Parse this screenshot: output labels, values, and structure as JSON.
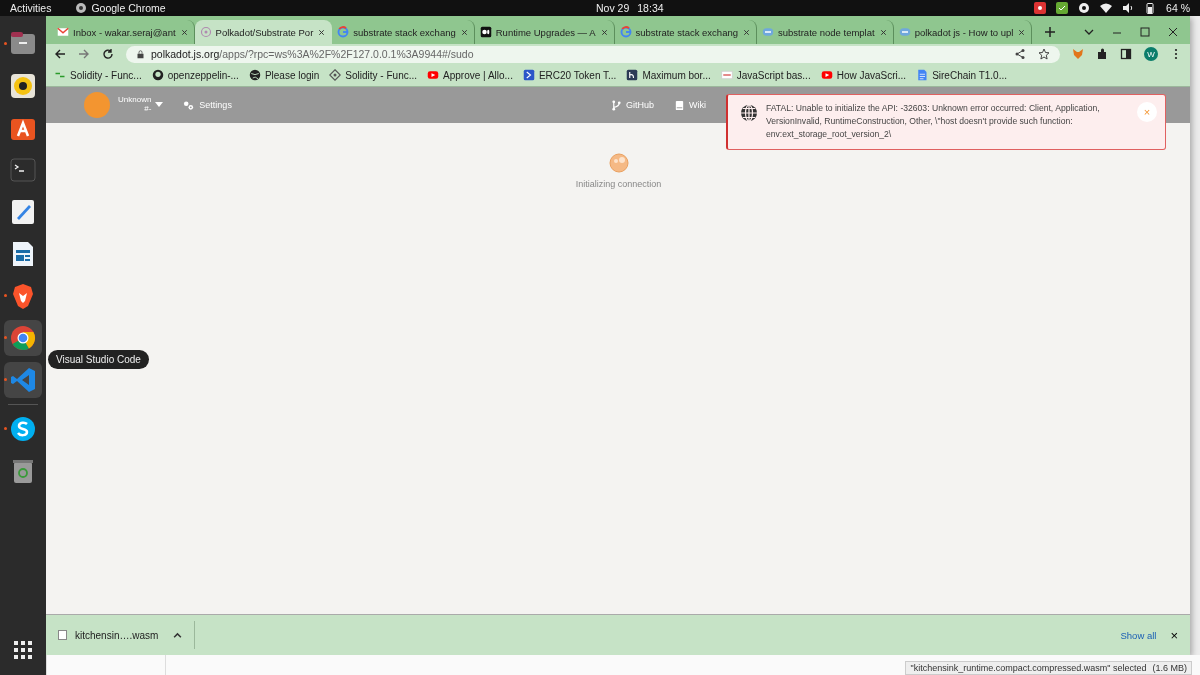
{
  "top_bar": {
    "activities": "Activities",
    "app_name": "Google Chrome",
    "date": "Nov 29",
    "time": "18:34",
    "battery": "64 %"
  },
  "dock": {
    "items": [
      {
        "kind": "files",
        "running": true,
        "highlighted": false
      },
      {
        "kind": "music",
        "running": false,
        "highlighted": false
      },
      {
        "kind": "store",
        "running": false,
        "highlighted": false
      },
      {
        "kind": "terminal",
        "running": false,
        "highlighted": false
      },
      {
        "kind": "editor",
        "running": false,
        "highlighted": false
      },
      {
        "kind": "writer",
        "running": false,
        "highlighted": false
      },
      {
        "kind": "brave",
        "running": true,
        "highlighted": false
      },
      {
        "kind": "chrome",
        "running": true,
        "highlighted": true
      },
      {
        "kind": "vscode",
        "running": true,
        "highlighted": true
      },
      {
        "kind": "skype",
        "running": true,
        "highlighted": false
      },
      {
        "kind": "trash",
        "running": false,
        "highlighted": false
      }
    ],
    "tooltip": "Visual Studio Code"
  },
  "browser": {
    "tabs": [
      {
        "kind": "gmail",
        "title": "Inbox - wakar.seraj@ant",
        "selected": false
      },
      {
        "kind": "polkadot",
        "title": "Polkadot/Substrate Por",
        "selected": true
      },
      {
        "kind": "google",
        "title": "substrate stack exchang",
        "selected": false
      },
      {
        "kind": "medium",
        "title": "Runtime Upgrades — A",
        "selected": false
      },
      {
        "kind": "google",
        "title": "substrate stack exchang",
        "selected": false
      },
      {
        "kind": "substrate",
        "title": "substrate node templat",
        "selected": false
      },
      {
        "kind": "substrate",
        "title": "polkadot js - How to upl",
        "selected": false
      }
    ],
    "url_host": "polkadot.js.org",
    "url_path": "/apps/?rpc=ws%3A%2F%2F127.0.0.1%3A9944#/sudo",
    "profile": "W",
    "bookmarks": [
      {
        "kind": "solidity",
        "label": "Solidity - Func..."
      },
      {
        "kind": "github",
        "label": "openzeppelin-..."
      },
      {
        "kind": "globe",
        "label": "Please login"
      },
      {
        "kind": "diamond",
        "label": "Solidity - Func..."
      },
      {
        "kind": "youtube",
        "label": "Approve | Allo..."
      },
      {
        "kind": "erc",
        "label": "ERC20 Token T..."
      },
      {
        "kind": "h",
        "label": "Maximum bor..."
      },
      {
        "kind": "js",
        "label": "JavaScript bas..."
      },
      {
        "kind": "youtube",
        "label": "How JavaScri..."
      },
      {
        "kind": "docs",
        "label": "SireChain T1.0..."
      }
    ]
  },
  "app": {
    "account_name": "Unknown",
    "account_index": "#-",
    "settings": "Settings",
    "links": [
      {
        "kind": "github",
        "label": "GitHub"
      },
      {
        "kind": "wiki",
        "label": "Wiki"
      }
    ],
    "loading": "Initializing connection",
    "error": {
      "message": "FATAL: Unable to initialize the API: -32603: Unknown error occurred: Client, Application, VersionInvalid, RuntimeConstruction, Other, \\\"host doesn't provide such function: env:ext_storage_root_version_2\\",
      "close": "×"
    }
  },
  "downloads": {
    "file": "kitchensin….wasm",
    "show_all": "Show all",
    "close": "×"
  },
  "file_status": {
    "selection": "\"kitchensink_runtime.compact.compressed.wasm\" selected",
    "size": "(1.6 MB)"
  }
}
